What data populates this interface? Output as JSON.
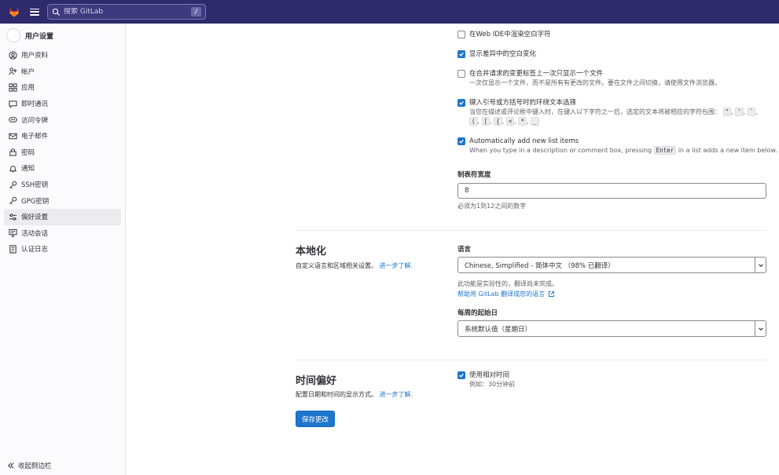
{
  "topbar": {
    "search_placeholder": "搜索 GitLab",
    "search_shortcut": "/"
  },
  "sidebar": {
    "title": "用户设置",
    "items": [
      {
        "label": "用户资料",
        "icon": "profile-icon"
      },
      {
        "label": "帐户",
        "icon": "account-icon"
      },
      {
        "label": "应用",
        "icon": "applications-icon"
      },
      {
        "label": "即时通讯",
        "icon": "chat-icon"
      },
      {
        "label": "访问令牌",
        "icon": "token-icon"
      },
      {
        "label": "电子邮件",
        "icon": "mail-icon"
      },
      {
        "label": "密码",
        "icon": "lock-icon"
      },
      {
        "label": "通知",
        "icon": "bell-icon"
      },
      {
        "label": "SSH密钥",
        "icon": "key-icon"
      },
      {
        "label": "GPG密钥",
        "icon": "key-icon"
      },
      {
        "label": "偏好设置",
        "icon": "preferences-icon",
        "active": true
      },
      {
        "label": "活动会话",
        "icon": "monitor-icon"
      },
      {
        "label": "认证日志",
        "icon": "log-icon"
      }
    ],
    "collapse_label": "收起侧边栏"
  },
  "behavior": {
    "render_whitespace": {
      "label": "在Web IDE中渲染空白字符",
      "checked": false
    },
    "show_whitespace_diffs": {
      "label": "显示差异中的空白变化",
      "checked": true
    },
    "single_file_diff": {
      "label": "在合并请求的变更标签上一次只显示一个文件",
      "help": "一次仅显示一个文件，而不是所有有更改的文件。要在文件之间切换，请使用文件浏览器。",
      "checked": false
    },
    "surround_selection": {
      "label": "键入引号或方括号时的环绕文本选择",
      "help_prefix": "当您在描述或评论框中键入时，在键入以下字符之一后，选定的文本将被相应的字符包围：",
      "chars": [
        "\"",
        "'",
        "`",
        "(",
        "[",
        "{",
        "<",
        "*",
        "_"
      ],
      "checked": true
    },
    "auto_list": {
      "label": "Automatically add new list items",
      "help_before": "When you type in a description or comment box, pressing",
      "help_key": "Enter",
      "help_after": "in a list adds a new item below.",
      "checked": true
    },
    "tab_width": {
      "label": "制表符宽度",
      "value": "8",
      "help": "必须为1到12之间的数字"
    }
  },
  "localization": {
    "title": "本地化",
    "description": "自定义语言和区域相关设置。",
    "learn_more": "进一步了解.",
    "language_label": "语言",
    "language_value": "Chinese, Simplified - 简体中文 （98% 已翻译）",
    "experimental_note": "此功能是实验性的，翻译尚未完成。",
    "help_translate": "帮助将 GitLab 翻译成您的语言",
    "first_day_label": "每周的起始日",
    "first_day_value": "系统默认值（星期日）"
  },
  "time_preferences": {
    "title": "时间偏好",
    "description": "配置日期和时间的显示方式。",
    "learn_more": "进一步了解.",
    "relative_time": {
      "label": "使用相对时间",
      "help": "例如：30分钟前",
      "checked": true
    }
  },
  "save_button": "保存更改",
  "colors": {
    "topbar": "#2f2a6b",
    "primary": "#1f75cb"
  }
}
